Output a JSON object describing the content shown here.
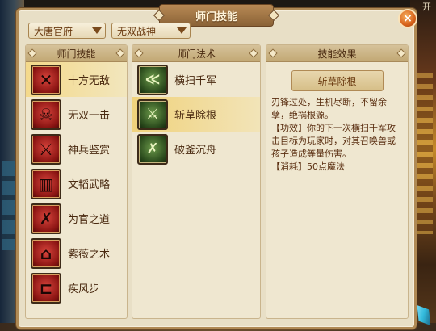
{
  "background": {
    "top_right_text": "开"
  },
  "panel": {
    "title": "师门技能",
    "close_label": "×"
  },
  "filters": {
    "faction": "大唐官府",
    "mode": "无双战神"
  },
  "columns": {
    "skills_header": "师门技能",
    "techniques_header": "师门法术",
    "effects_header": "技能效果"
  },
  "skills": [
    {
      "label": "十方无敌",
      "glyph": "✕"
    },
    {
      "label": "无双一击",
      "glyph": "☠"
    },
    {
      "label": "神兵鉴赏",
      "glyph": "⚔"
    },
    {
      "label": "文韬武略",
      "glyph": "▥"
    },
    {
      "label": "为官之道",
      "glyph": "✗"
    },
    {
      "label": "紫薇之术",
      "glyph": "⌂"
    },
    {
      "label": "疾风步",
      "glyph": "⊏"
    }
  ],
  "techniques": [
    {
      "label": "横扫千军",
      "glyph": "≪"
    },
    {
      "label": "斩草除根",
      "glyph": "⚔"
    },
    {
      "label": "破釜沉舟",
      "glyph": "✗"
    }
  ],
  "effect": {
    "name": "斩草除根",
    "description": "刃锋过处，生机尽断，不留余孽，绝祸根源。",
    "function_line": "【功效】你的下一次横扫千军攻击目标为玩家时，对其召唤兽或孩子造成等量伤害。",
    "cost_line": "【消耗】50点魔法"
  },
  "colors": {
    "accent": "#b08a55",
    "selected_row": "#f4d98a",
    "close_button": "#d8621a"
  }
}
